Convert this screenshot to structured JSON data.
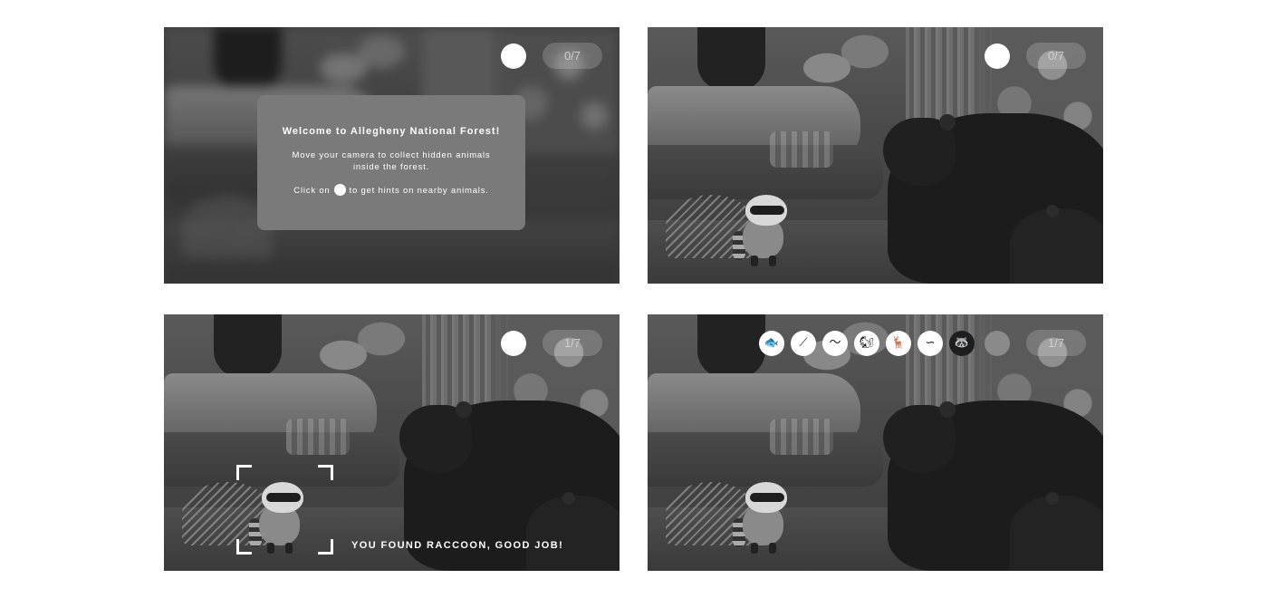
{
  "panels": {
    "welcome_screen": {
      "counter": "0/7",
      "dialog": {
        "title": "Welcome to Allegheny National Forest!",
        "message": "Move your camera to collect hidden animals inside the forest.",
        "hint_prefix": "Click on",
        "hint_suffix": "to get hints on nearby animals."
      }
    },
    "camera_view": {
      "counter": "0/7"
    },
    "found_view": {
      "counter": "1/7",
      "found_message": "YOU FOUND RACCOON, GOOD JOB!"
    },
    "hints_view": {
      "counter": "1/7",
      "animal_icons": [
        {
          "icon": "fish-icon",
          "glyph": "🐟",
          "found": false
        },
        {
          "icon": "feather-icon",
          "glyph": "⟋",
          "found": false
        },
        {
          "icon": "lizard-icon",
          "glyph": "〜",
          "found": false
        },
        {
          "icon": "squirrel-icon",
          "glyph": "🐿",
          "found": false
        },
        {
          "icon": "deer-icon",
          "glyph": "🦌",
          "found": false
        },
        {
          "icon": "snake-icon",
          "glyph": "∽",
          "found": false
        },
        {
          "icon": "raccoon-icon",
          "glyph": "🦝",
          "found": true
        }
      ]
    }
  },
  "colors": {
    "hud_white": "#ffffff",
    "dialog_bg": "#7a7a7a",
    "hint_inactive": "#8a8a8a"
  }
}
